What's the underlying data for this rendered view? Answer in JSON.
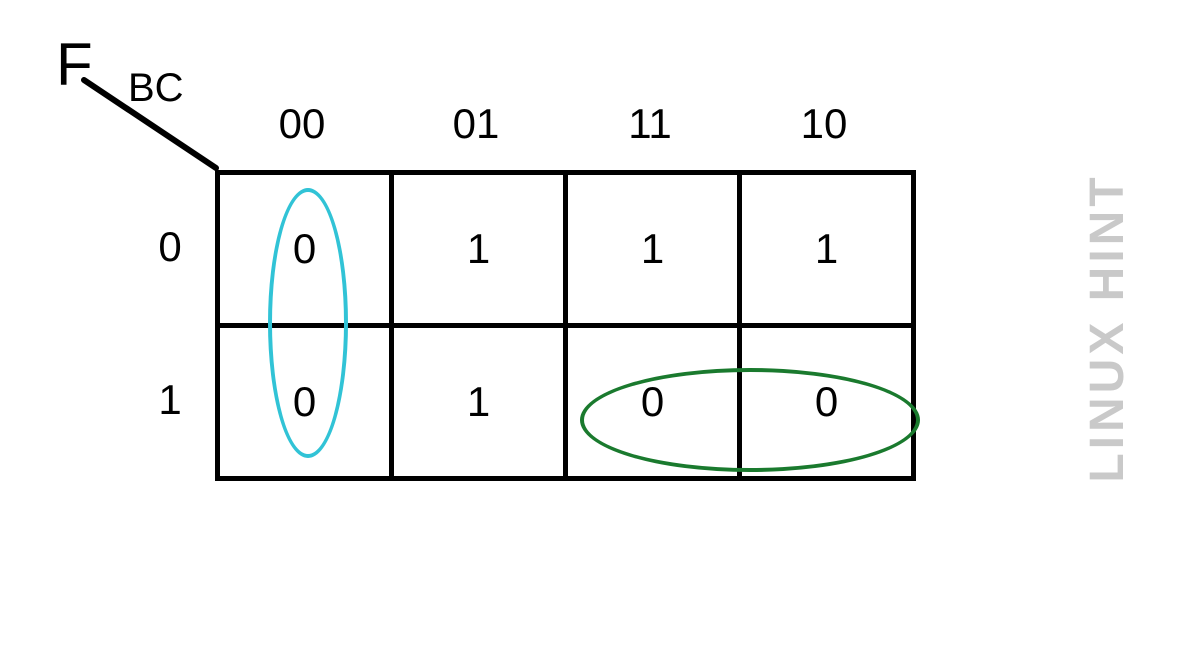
{
  "kmap": {
    "function_label": "F",
    "col_var_label": "BC",
    "col_headers": [
      "00",
      "01",
      "11",
      "10"
    ],
    "row_headers": [
      "0",
      "1"
    ],
    "cells": [
      [
        "0",
        "1",
        "1",
        "1"
      ],
      [
        "0",
        "1",
        "0",
        "0"
      ]
    ],
    "groups": [
      {
        "name": "group-col00",
        "color": "#31c3d6",
        "covers": [
          [
            0,
            0
          ],
          [
            1,
            0
          ]
        ]
      },
      {
        "name": "group-row1-11-10",
        "color": "#1a7a2e",
        "covers": [
          [
            1,
            2
          ],
          [
            1,
            3
          ]
        ]
      }
    ]
  },
  "watermark": "LINUX HINT"
}
